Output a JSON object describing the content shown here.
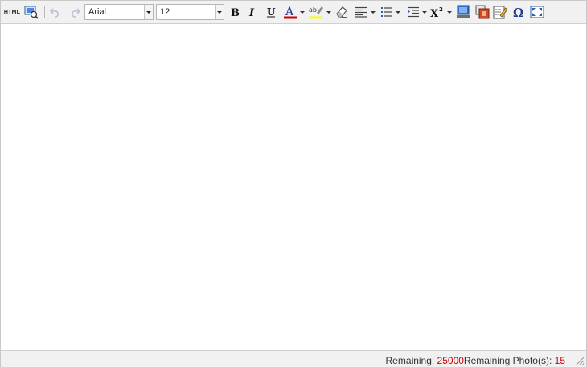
{
  "toolbar": {
    "html_label": "HTML",
    "font_family": "Arial",
    "font_size": "12",
    "icons": [
      "source-html-icon",
      "preview-icon",
      "undo-icon",
      "redo-icon",
      "bold-icon",
      "italic-icon",
      "underline-icon",
      "font-color-icon",
      "highlight-color-icon",
      "eraser-icon",
      "align-icon",
      "list-icon",
      "indent-icon",
      "superscript-icon",
      "insert-image-icon",
      "insert-media-icon",
      "edit-icon",
      "special-char-icon",
      "fullscreen-icon"
    ],
    "font_color": "#d40000",
    "highlight_color": "#ffff00"
  },
  "status": {
    "remaining_label": "Remaining: ",
    "remaining_value": "25000",
    "photos_label": "Remaining Photo(s): ",
    "photos_value": "15"
  }
}
